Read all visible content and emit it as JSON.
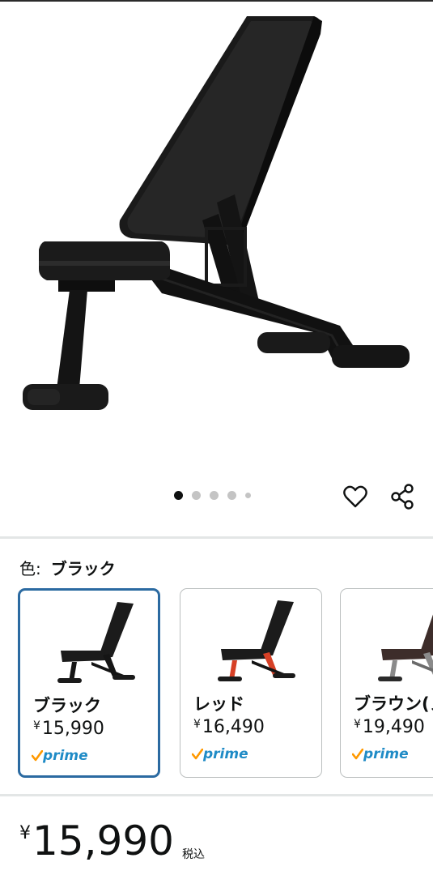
{
  "gallery": {
    "image_alt": "adjustable weight bench",
    "dot_count": 5,
    "active_dot": 0
  },
  "color": {
    "label": "色:",
    "selected": "ブラック"
  },
  "variants": [
    {
      "name": "ブラック",
      "currency": "¥",
      "price": "15,990",
      "prime": "prime",
      "accent": "#0f1111",
      "selected": true
    },
    {
      "name": "レッド",
      "currency": "¥",
      "price": "16,490",
      "prime": "prime",
      "accent": "#d64026",
      "selected": false
    },
    {
      "name": "ブラウン(ノ",
      "currency": "¥",
      "price": "19,490",
      "prime": "prime",
      "accent": "#5a4540",
      "selected": false
    }
  ],
  "price": {
    "currency": "¥",
    "amount": "15,990",
    "tax_note": "税込"
  },
  "colors": {
    "selected_border": "#2b6aa1",
    "prime_blue": "#00a8e1",
    "prime_check": "#f90"
  }
}
